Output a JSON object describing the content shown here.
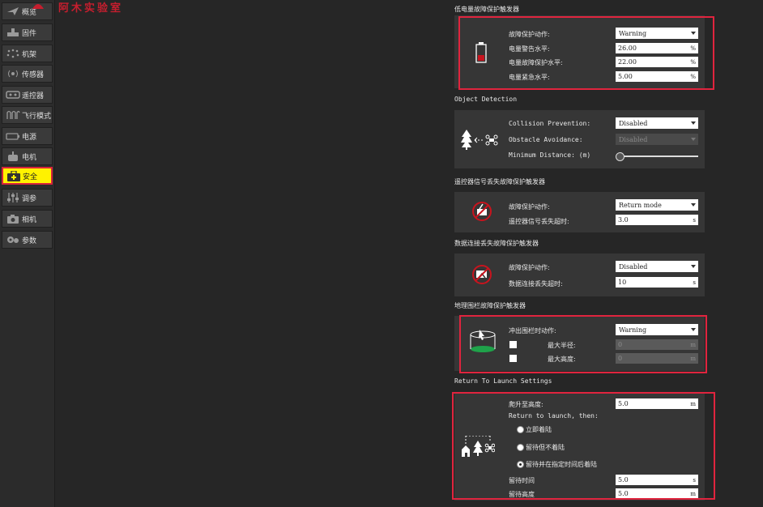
{
  "sidebar": {
    "items": [
      {
        "label": "概览",
        "icon": "paper-plane-icon"
      },
      {
        "label": "固件",
        "icon": "firmware-icon"
      },
      {
        "label": "机架",
        "icon": "airframe-icon"
      },
      {
        "label": "传感器",
        "icon": "sensor-icon"
      },
      {
        "label": "遥控器",
        "icon": "radio-icon"
      },
      {
        "label": "飞行模式",
        "icon": "flight-modes-icon"
      },
      {
        "label": "电源",
        "icon": "battery-icon"
      },
      {
        "label": "电机",
        "icon": "motor-icon"
      },
      {
        "label": "安全",
        "icon": "safety-icon"
      },
      {
        "label": "调参",
        "icon": "tuning-icon"
      },
      {
        "label": "相机",
        "icon": "camera-icon"
      },
      {
        "label": "参数",
        "icon": "parameters-icon"
      }
    ],
    "active_label": "安全"
  },
  "logo": {
    "text": "阿木实验室"
  },
  "battery": {
    "title": "低电量故障保护触发器",
    "action_label": "故障保护动作:",
    "action_value": "Warning",
    "warn_label": "电量警告水平:",
    "warn_value": "26.00",
    "failsafe_label": "电量故障保护水平:",
    "failsafe_value": "22.00",
    "emergency_label": "电量紧急水平:",
    "emergency_value": "5.00",
    "unit": "%"
  },
  "object_detection": {
    "title": "Object Detection",
    "collision_label": "Collision Prevention:",
    "collision_value": "Disabled",
    "avoidance_label": "Obstacle Avoidance:",
    "avoidance_value": "Disabled",
    "min_distance_label": "Minimum Distance: (m)",
    "min_distance_fraction": 0.0
  },
  "rc_loss": {
    "title": "遥控器信号丢失故障保护触发器",
    "action_label": "故障保护动作:",
    "action_value": "Return mode",
    "timeout_label": "遥控器信号丢失超时:",
    "timeout_value": "3.0",
    "unit": "s"
  },
  "data_link": {
    "title": "数据连接丢失故障保护触发器",
    "action_label": "故障保护动作:",
    "action_value": "Disabled",
    "timeout_label": "数据连接丢失超时:",
    "timeout_value": "10",
    "unit": "s"
  },
  "geofence": {
    "title": "地理围栏故障保护触发器",
    "action_label": "冲出围栏时动作:",
    "action_value": "Warning",
    "radius_label": "最大半径:",
    "radius_value": "0",
    "altitude_label": "最大高度:",
    "altitude_value": "0",
    "unit": "m"
  },
  "rtl": {
    "title": "Return To Launch Settings",
    "climb_label": "爬升至高度:",
    "climb_value": "5.0",
    "then_label": "Return to launch, then:",
    "option1": "立即着陆",
    "option2": "留待但不着陆",
    "option3": "留待并在指定时间后着陆",
    "loiter_time_label": "留待时间",
    "loiter_time_value": "5.0",
    "loiter_time_unit": "s",
    "loiter_alt_label": "留待高度",
    "loiter_alt_value": "5.0",
    "unit_m": "m"
  },
  "colors": {
    "highlight": "#fff200",
    "annotation": "#e0243e",
    "panel": "#363636",
    "background": "#262626"
  }
}
